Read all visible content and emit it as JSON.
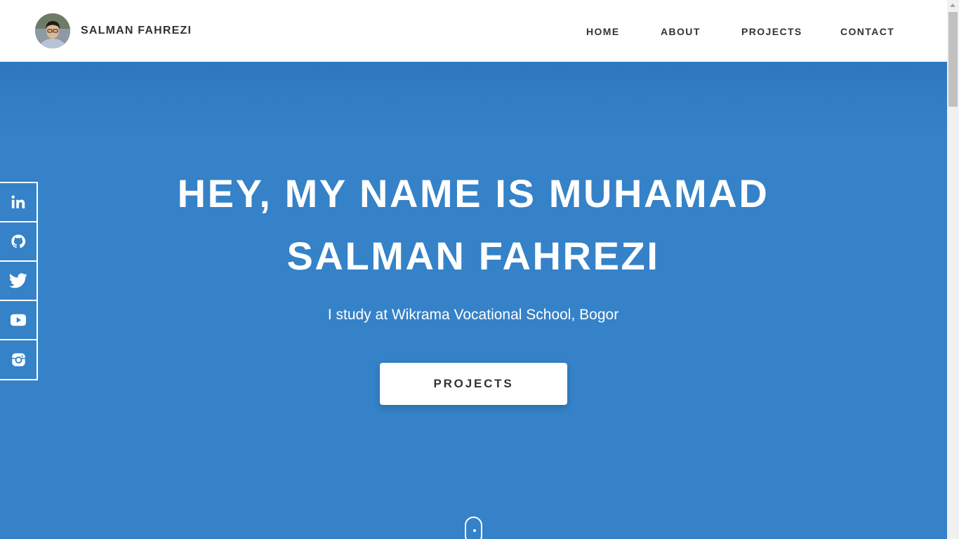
{
  "brand": {
    "name": "SALMAN FAHREZI",
    "avatar_icon": "avatar-photo"
  },
  "nav": {
    "items": [
      {
        "label": "HOME"
      },
      {
        "label": "ABOUT"
      },
      {
        "label": "PROJECTS"
      },
      {
        "label": "CONTACT"
      }
    ]
  },
  "hero": {
    "title_line1": "HEY, MY NAME IS MUHAMAD",
    "title_line2": "SALMAN FAHREZI",
    "subtitle": "I study at Wikrama Vocational School, Bogor",
    "button_label": "PROJECTS"
  },
  "social": {
    "items": [
      {
        "icon": "linkedin-icon"
      },
      {
        "icon": "github-icon"
      },
      {
        "icon": "twitter-icon"
      },
      {
        "icon": "youtube-icon"
      },
      {
        "icon": "instagram-icon"
      }
    ]
  },
  "colors": {
    "hero_background": "#3582c8",
    "header_background": "#ffffff",
    "text_dark": "#333333",
    "text_light": "#ffffff"
  }
}
